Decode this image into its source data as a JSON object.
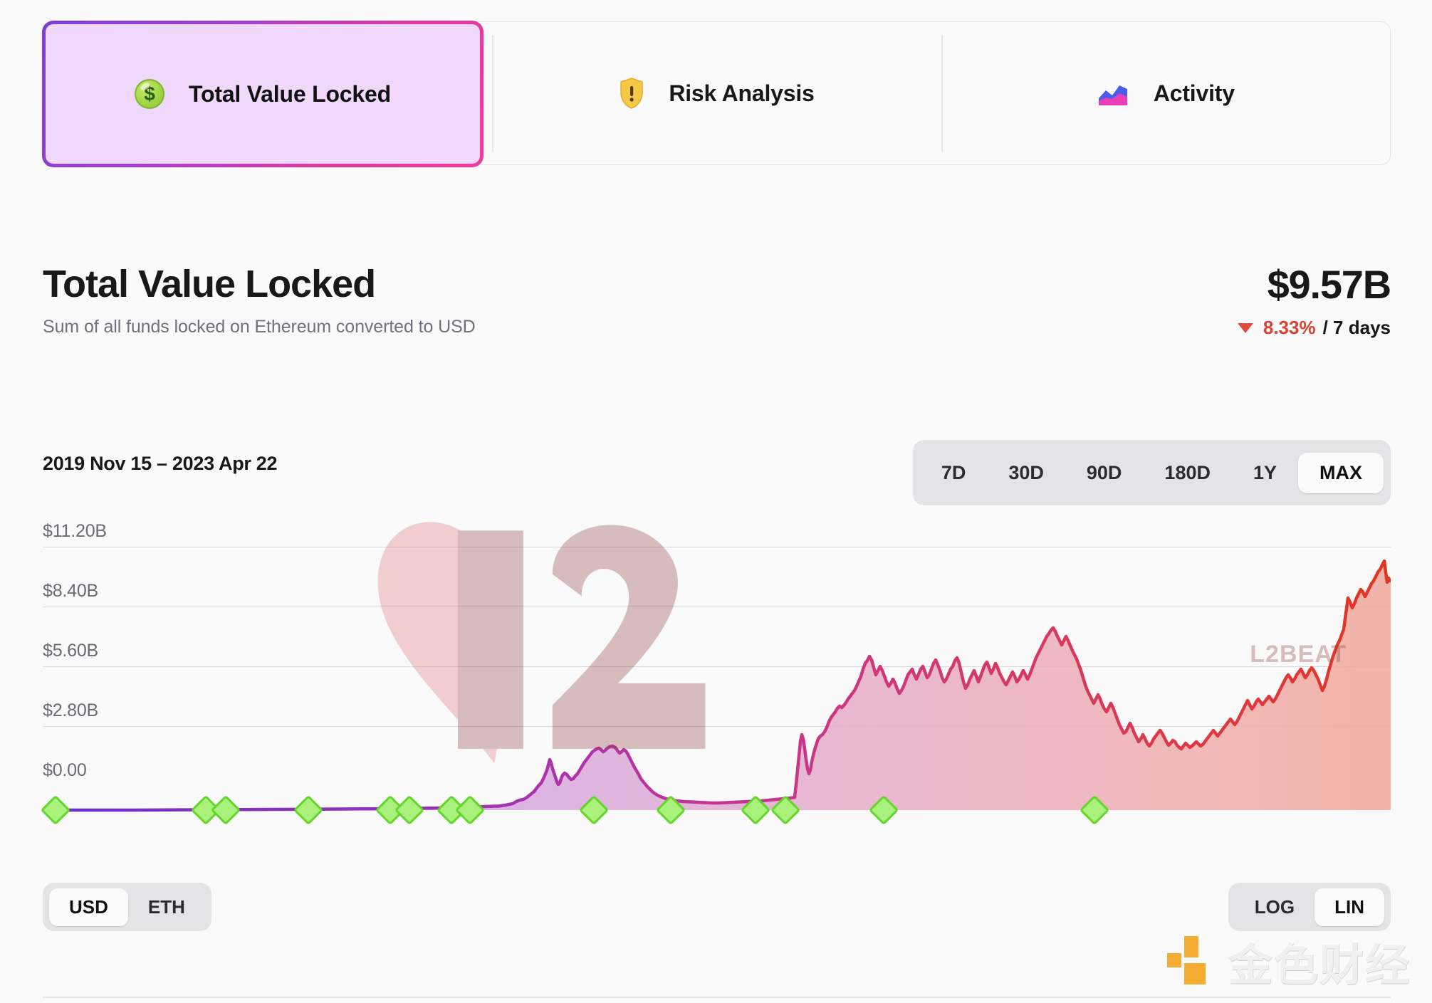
{
  "tabs": [
    {
      "label": "Total Value Locked",
      "icon": "money-bag-icon",
      "active": true
    },
    {
      "label": "Risk Analysis",
      "icon": "shield-warning-icon",
      "active": false
    },
    {
      "label": "Activity",
      "icon": "area-chart-icon",
      "active": false
    }
  ],
  "header": {
    "title": "Total Value Locked",
    "subtitle": "Sum of all funds locked on Ethereum converted to USD",
    "value": "$9.57B",
    "change_pct": "8.33%",
    "change_period": "/ 7 days",
    "change_direction": "down",
    "change_color": "#d94436"
  },
  "range": {
    "date_range": "2019 Nov 15 – 2023 Apr 22",
    "periods": [
      "7D",
      "30D",
      "90D",
      "180D",
      "1Y",
      "MAX"
    ],
    "active_period": "MAX"
  },
  "controls": {
    "currency": {
      "options": [
        "USD",
        "ETH"
      ],
      "active": "USD"
    },
    "scale": {
      "options": [
        "LOG",
        "LIN"
      ],
      "active": "LIN"
    }
  },
  "watermarks": {
    "chart": "L2BEAT",
    "corner": "金色财经"
  },
  "chart_data": {
    "type": "area",
    "title": "Total Value Locked",
    "xlabel": "",
    "ylabel": "USD",
    "ylim": [
      0,
      11200000000
    ],
    "grid": true,
    "legend": "none",
    "y_ticks": [
      "$0.00",
      "$2.80B",
      "$5.60B",
      "$8.40B",
      "$11.20B"
    ],
    "y_tick_values": [
      0,
      2800000000,
      5600000000,
      8400000000,
      11200000000
    ],
    "x_start": "2019 Nov 15",
    "x_end": "2023 Apr 22",
    "line_gradient": [
      "#7b2fd0",
      "#c0399f",
      "#e0405f",
      "#e03a2a"
    ],
    "fill_gradient": [
      "#d9b7ec",
      "#e8b4cf",
      "#f0b0a8"
    ],
    "milestone_marker_color": "#a9f07c",
    "milestone_marker_border": "#62d62a",
    "milestones_x_pct": [
      1.0,
      12.2,
      13.7,
      19.8,
      26.0,
      27.3,
      30.4,
      31.8,
      41.0,
      46.8,
      53.0,
      55.2,
      62.5,
      78.1
    ],
    "series": [
      {
        "name": "Total Value Locked (USD)",
        "x": [
          "2019-11-15",
          "2020-01-01",
          "2020-03-01",
          "2020-05-01",
          "2020-07-01",
          "2020-09-01",
          "2020-11-01",
          "2021-01-01",
          "2021-02-15",
          "2021-04-01",
          "2021-05-15",
          "2021-07-01",
          "2021-08-15",
          "2021-10-01",
          "2021-11-15",
          "2022-01-01",
          "2022-02-15",
          "2022-04-01",
          "2022-05-15",
          "2022-07-01",
          "2022-08-15",
          "2022-10-01",
          "2022-11-15",
          "2023-01-01",
          "2023-02-15",
          "2023-03-15",
          "2023-04-01",
          "2023-04-22"
        ],
        "values": [
          0.01,
          0.02,
          0.03,
          0.05,
          0.08,
          0.15,
          0.3,
          0.55,
          1.3,
          0.85,
          1.6,
          1.4,
          0.8,
          0.7,
          2.9,
          6.1,
          5.2,
          5.8,
          4.1,
          3.3,
          5.0,
          4.6,
          3.3,
          3.6,
          4.8,
          5.9,
          8.1,
          9.57
        ],
        "unit": "B USD"
      }
    ]
  }
}
